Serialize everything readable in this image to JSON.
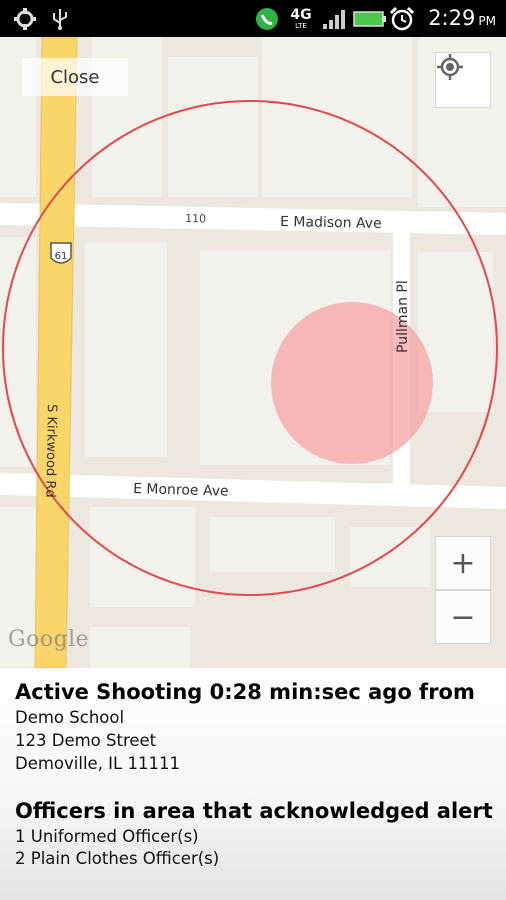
{
  "status_bar": {
    "icons": [
      "usb-debugging-icon",
      "usb-icon",
      "phone-signal-icon",
      "4g-lte-icon",
      "signal-bars-icon",
      "battery-icon",
      "alarm-icon"
    ],
    "network_label": "4G",
    "network_sub": "LTE",
    "time": "2:29",
    "ampm": "PM"
  },
  "map": {
    "close_label": "Close",
    "zoom_in_label": "+",
    "zoom_out_label": "−",
    "streets": {
      "madison": "E Madison Ave",
      "madison_number": "110",
      "monroe": "E Monroe Ave",
      "pullman": "Pullman Pl",
      "kirkwood": "S Kirkwood Rd",
      "route_shield": "61"
    },
    "logo": "Google",
    "colors": {
      "alert_circle": "#e8474a",
      "alert_fill": "#f5a4a4",
      "highway": "#f9d56a",
      "land": "#ece8df",
      "block": "#f3f1ec"
    }
  },
  "alert": {
    "title": "Active Shooting 0:28 min:sec ago from",
    "location_name": "Demo School",
    "street": "123 Demo Street",
    "city": "Demoville, IL 11111"
  },
  "officers": {
    "title": "Officers in area that acknowledged alert",
    "uniformed": "1 Uniformed Officer(s)",
    "plain_clothes": "2 Plain Clothes Officer(s)"
  }
}
